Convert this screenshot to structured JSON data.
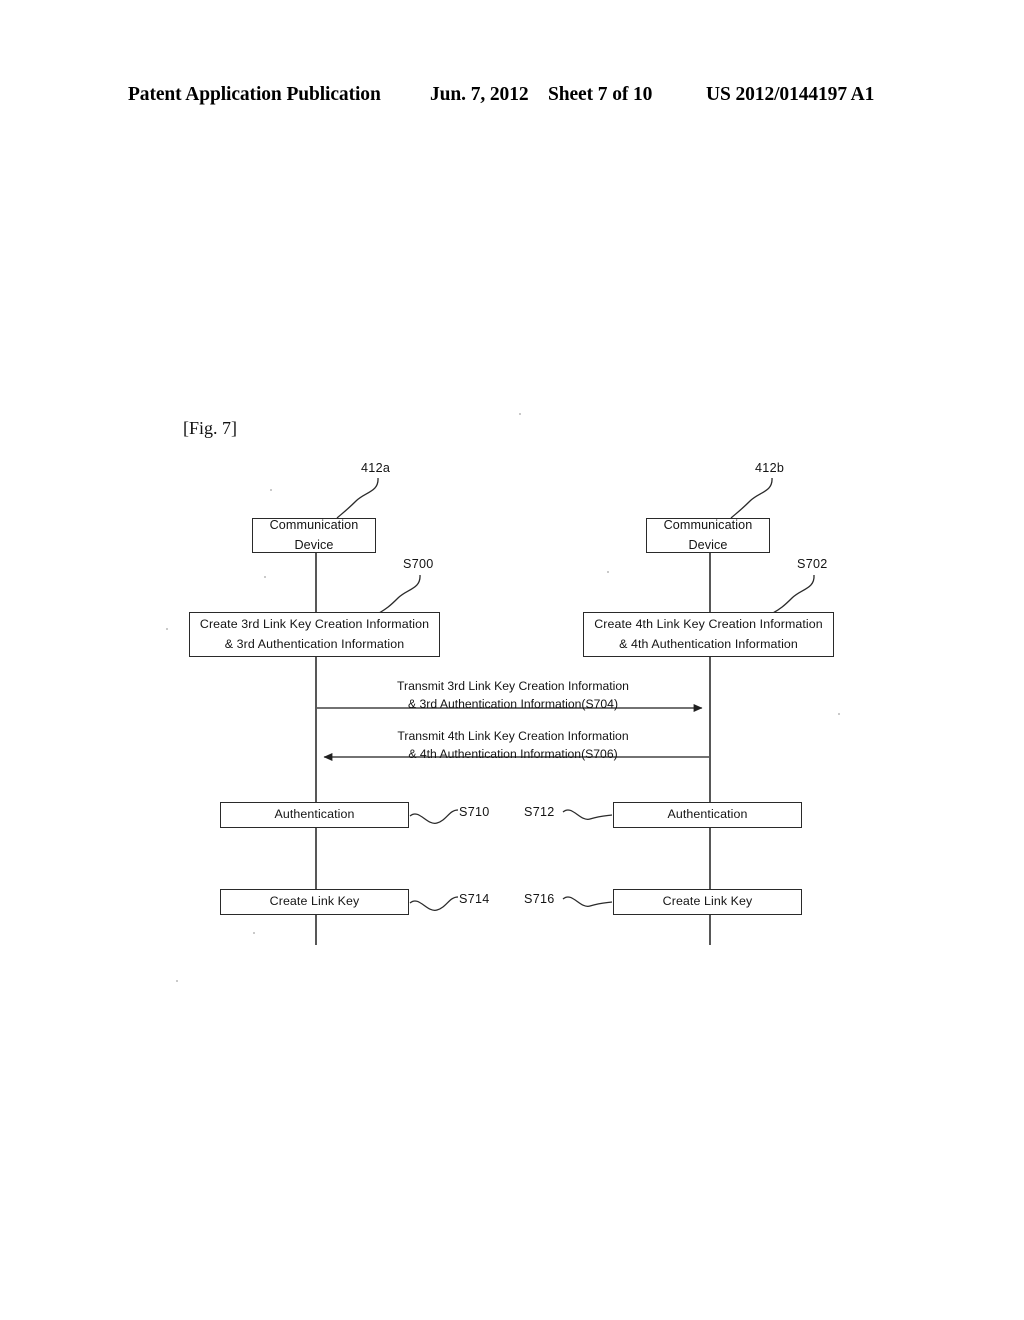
{
  "header": {
    "publication": "Patent Application Publication",
    "date": "Jun. 7, 2012",
    "sheet": "Sheet 7 of 10",
    "patent_number": "US 2012/0144197 A1"
  },
  "figure": {
    "label": "[Fig. 7]"
  },
  "diagram": {
    "lifelines": [
      {
        "name": "left-lifeline",
        "ref": "412a"
      },
      {
        "name": "right-lifeline",
        "ref": "412b"
      }
    ],
    "left": {
      "ref": "412a",
      "device_line1": "Communication",
      "device_line2": "Device",
      "create_step_ref": "S700",
      "create_line1": "Create 3rd Link Key Creation Information",
      "create_line2": "& 3rd Authentication Information",
      "auth_label": "Authentication",
      "auth_ref": "S710",
      "linkkey_label": "Create Link Key",
      "linkkey_ref": "S714"
    },
    "right": {
      "ref": "412b",
      "device_line1": "Communication",
      "device_line2": "Device",
      "create_step_ref": "S702",
      "create_line1": "Create 4th Link Key Creation Information",
      "create_line2": "& 4th Authentication Information",
      "auth_label": "Authentication",
      "auth_ref": "S712",
      "linkkey_label": "Create Link Key",
      "linkkey_ref": "S716"
    },
    "messages": [
      {
        "name": "message-s704",
        "direction": "left-to-right",
        "line1": "Transmit 3rd Link Key Creation Information",
        "line2": "& 3rd Authentication Information(S704)"
      },
      {
        "name": "message-s706",
        "direction": "right-to-left",
        "line1": "Transmit 4th Link Key Creation Information",
        "line2": "& 4th Authentication Information(S706)"
      }
    ]
  },
  "colors": {
    "ink": "#141414",
    "line": "#2a2a2a",
    "paper": "#ffffff"
  }
}
